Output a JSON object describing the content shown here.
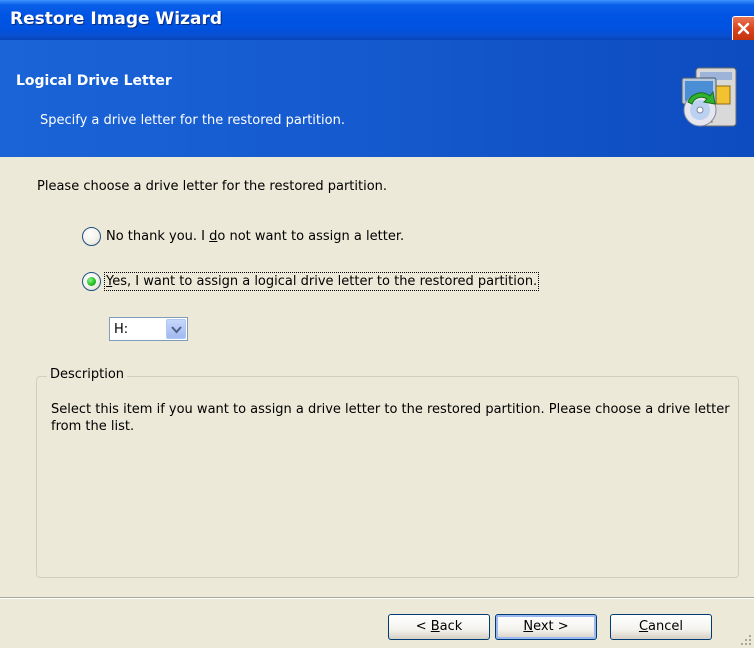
{
  "window": {
    "title": "Restore Image Wizard"
  },
  "header": {
    "title": "Logical Drive Letter",
    "subtitle": "Specify a drive letter for the restored partition.",
    "icon": "restore-wizard-icon"
  },
  "content": {
    "prompt": "Please choose a drive letter for the restored partition.",
    "options": [
      {
        "label_before": "No thank you. I ",
        "label_ul": "d",
        "label_after": "o not want to assign a letter.",
        "selected": false
      },
      {
        "label_before": "",
        "label_ul": "Y",
        "label_after": "es, I want to assign a logical drive letter to the restored partition.",
        "selected": true
      }
    ],
    "drive_select": {
      "value": "H:"
    },
    "description": {
      "legend": "Description",
      "text": "Select this item if you want to assign a drive letter to the restored partition. Please choose a drive letter from the list."
    }
  },
  "buttons": {
    "back": {
      "before": "< ",
      "ul": "B",
      "after": "ack"
    },
    "next": {
      "before": "",
      "ul": "N",
      "after": "ext >"
    },
    "cancel": {
      "before": "",
      "ul": "C",
      "after": "ancel"
    }
  },
  "colors": {
    "titlebar": "#0054e3",
    "header": "#1458cc",
    "dialog_bg": "#ece9d8",
    "radio_checked": "#24c324",
    "close_button": "#d9441f"
  }
}
